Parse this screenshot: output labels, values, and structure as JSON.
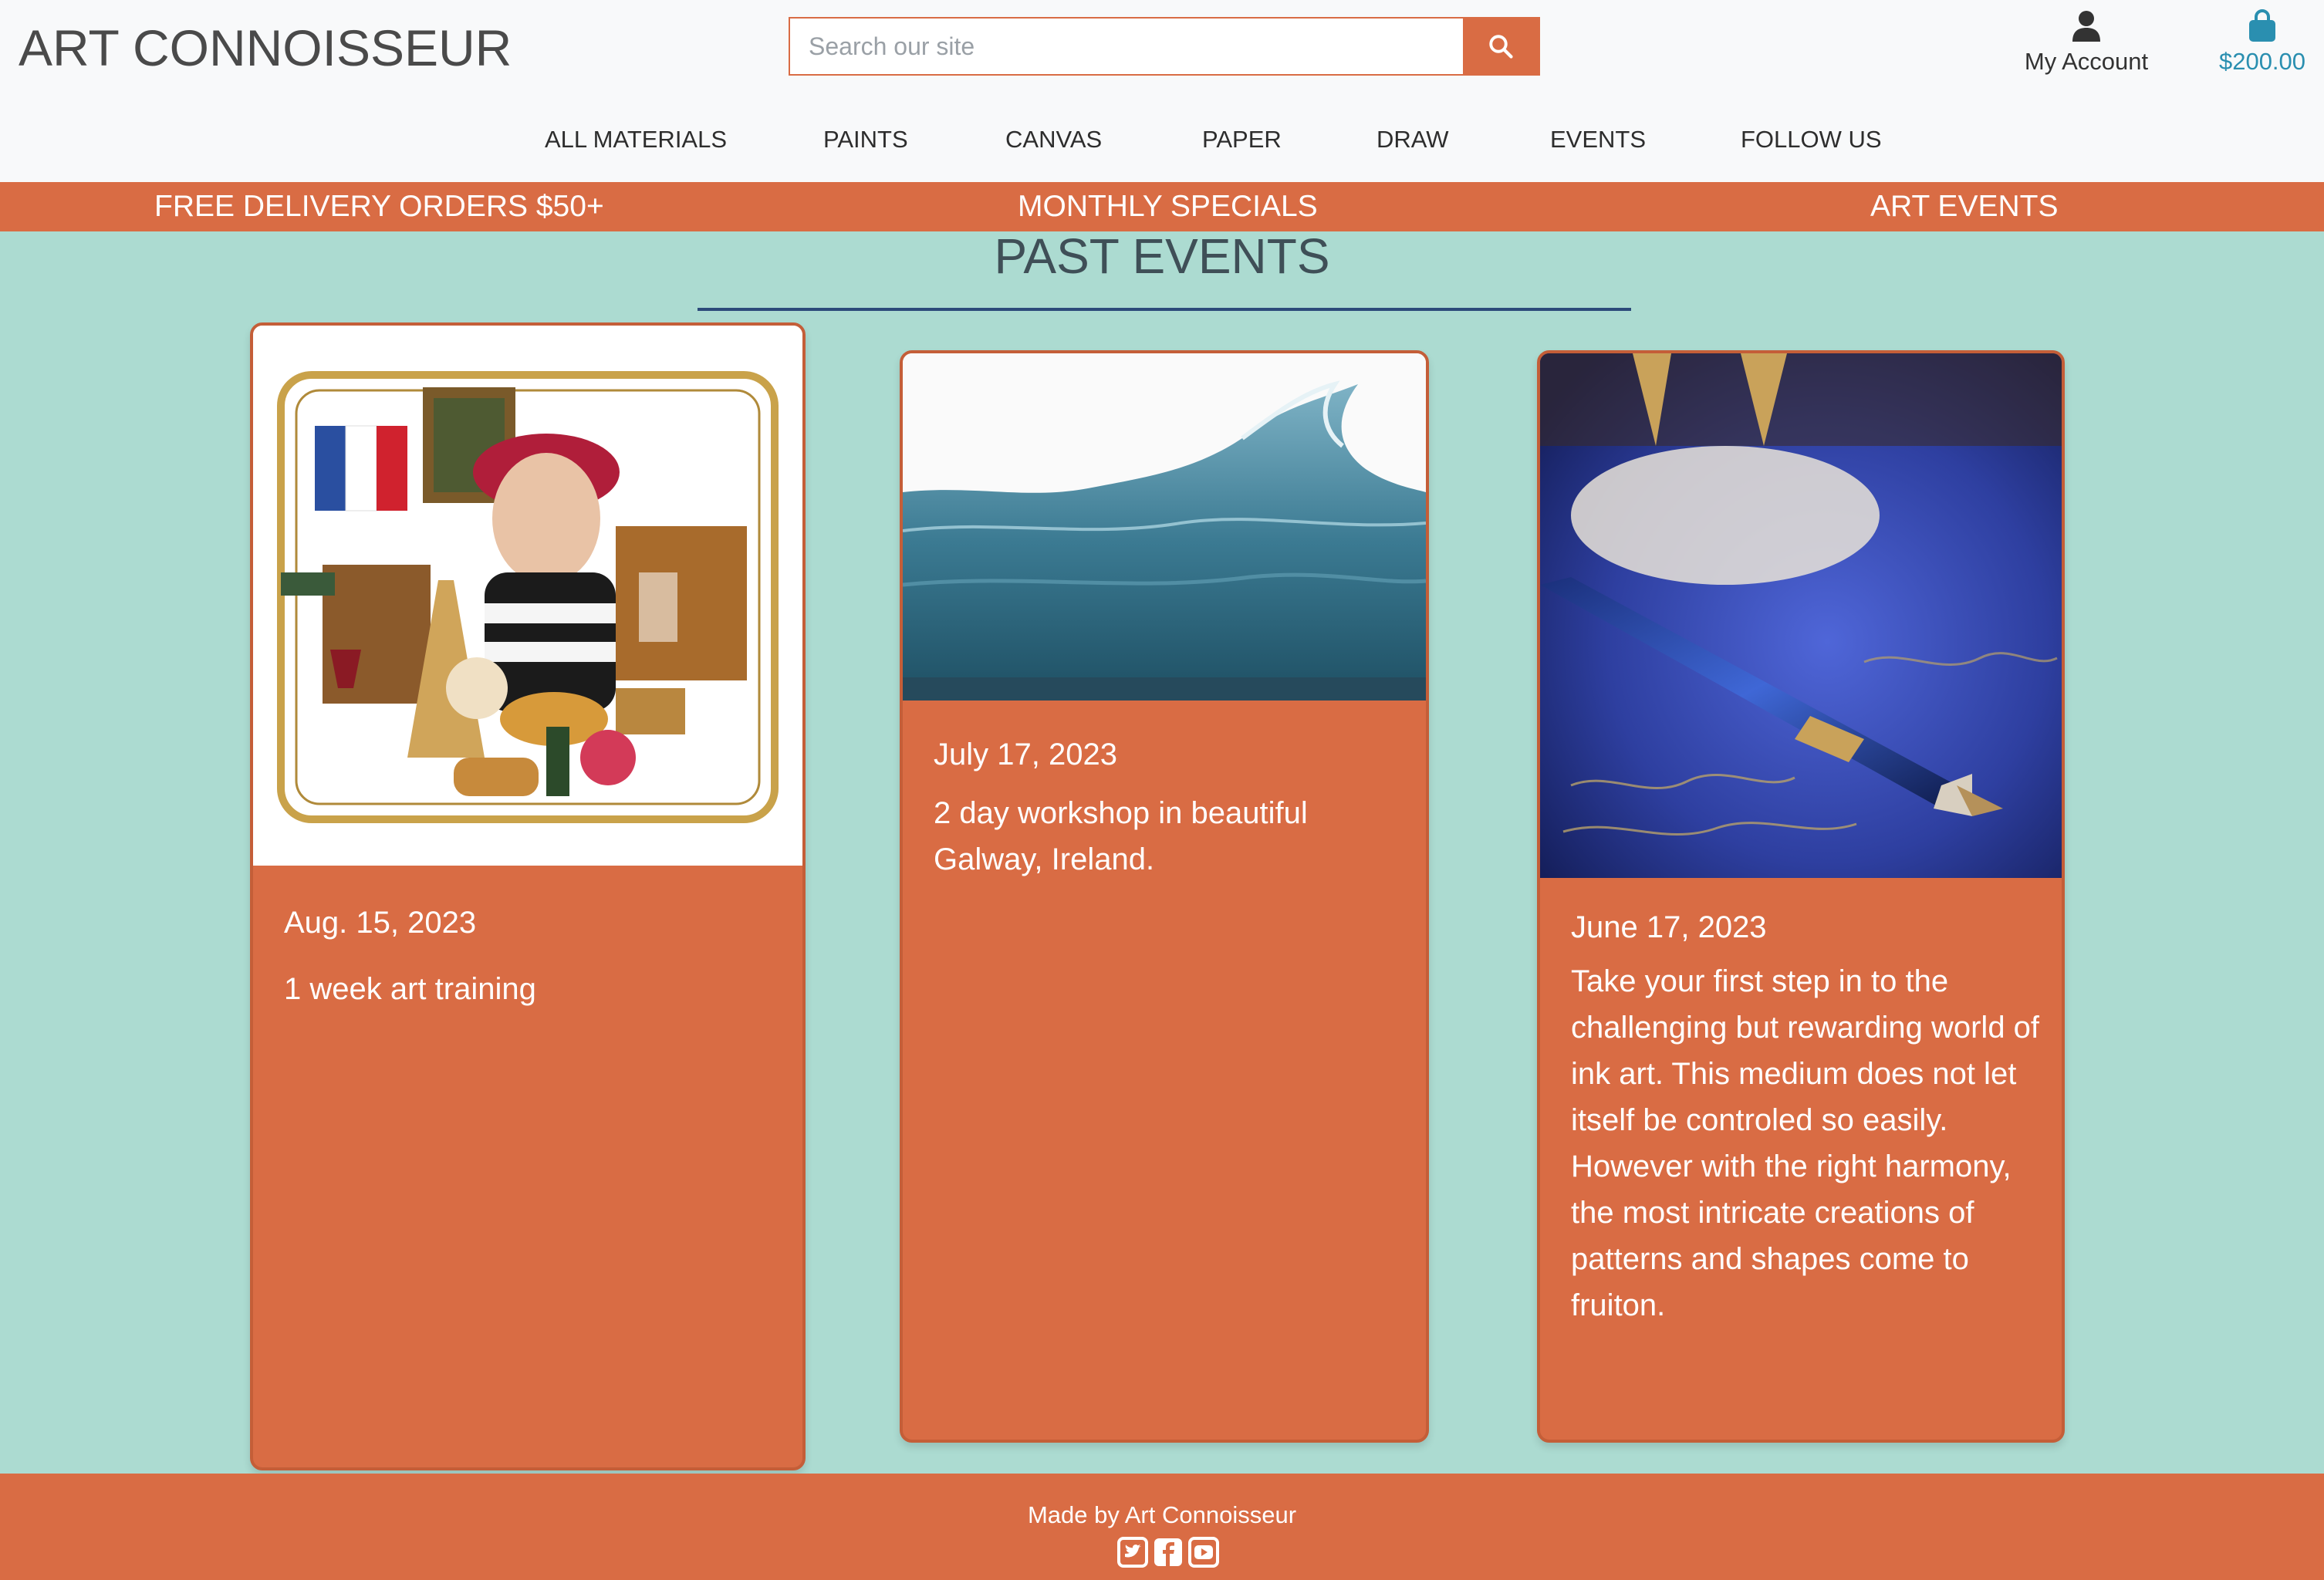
{
  "header": {
    "logo": "ART CONNOISSEUR",
    "search_placeholder": "Search our site",
    "account_label": "My Account",
    "cart_total": "$200.00"
  },
  "nav": {
    "items": [
      "ALL MATERIALS",
      "PAINTS",
      "CANVAS",
      "PAPER",
      "DRAW",
      "EVENTS",
      "FOLLOW US"
    ]
  },
  "promo": {
    "items": [
      "FREE DELIVERY ORDERS $50+",
      "MONTHLY SPECIALS",
      "ART EVENTS"
    ]
  },
  "main": {
    "title": "PAST EVENTS",
    "events": [
      {
        "date": "Aug. 15, 2023",
        "description": "1 week art training"
      },
      {
        "date": "July 17, 2023",
        "description": "2 day workshop in beautiful Galway, Ireland."
      },
      {
        "date": "June 17, 2023",
        "description": "Take your first step in to the challenging but rewarding world of ink art. This medium does not let itself be controled so easily. However with the right harmony, the most intricate creations of patterns and shapes come to fruiton."
      }
    ]
  },
  "footer": {
    "text": "Made by Art Connoisseur",
    "social_icons": [
      "twitter-icon",
      "facebook-icon",
      "youtube-icon"
    ]
  },
  "colors": {
    "accent": "#d96c44",
    "background": "#acdbd1",
    "header_bg": "#f8f9fa",
    "cart_text": "#2a8fb0"
  }
}
